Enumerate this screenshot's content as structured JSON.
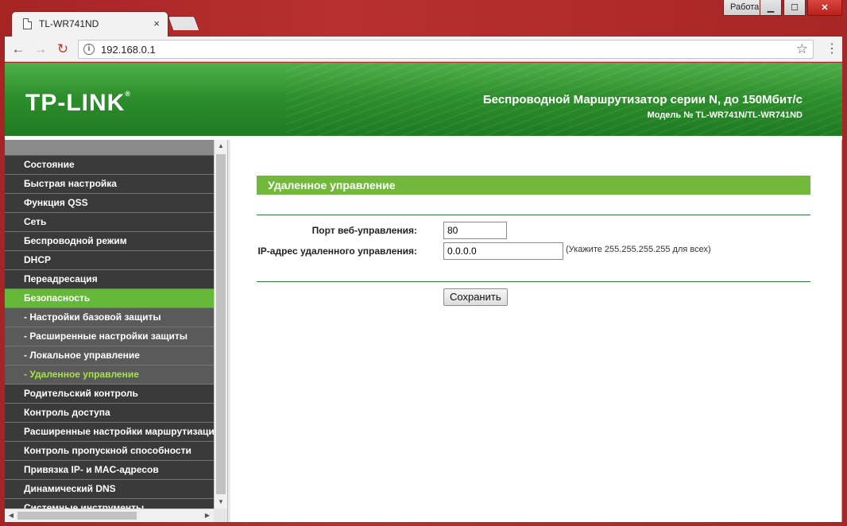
{
  "window": {
    "profile_label": "Работа",
    "minimize_icon": "minimize-icon",
    "maximize_icon": "maximize-icon",
    "close_icon": "close-icon"
  },
  "tab": {
    "title": "TL-WR741ND",
    "close_glyph": "×"
  },
  "toolbar": {
    "back_glyph": "←",
    "forward_glyph": "→",
    "reload_glyph": "↻",
    "url": "192.168.0.1",
    "info_glyph": "i",
    "star_glyph": "☆",
    "menu_glyph": "⋮"
  },
  "banner": {
    "logo": "TP-LINK",
    "logo_mark": "®",
    "headline": "Беспроводной Маршрутизатор серии N, до 150Мбит/с",
    "model": "Модель № TL-WR741N/TL-WR741ND"
  },
  "sidebar": {
    "items": [
      {
        "label": "Состояние",
        "kind": "main"
      },
      {
        "label": "Быстрая настройка",
        "kind": "main"
      },
      {
        "label": "Функция QSS",
        "kind": "main"
      },
      {
        "label": "Сеть",
        "kind": "main"
      },
      {
        "label": "Беспроводной режим",
        "kind": "main"
      },
      {
        "label": "DHCP",
        "kind": "main"
      },
      {
        "label": "Переадресация",
        "kind": "main"
      },
      {
        "label": "Безопасность",
        "kind": "active"
      },
      {
        "label": "- Настройки базовой защиты",
        "kind": "sub"
      },
      {
        "label": "- Расширенные настройки защиты",
        "kind": "sub"
      },
      {
        "label": "- Локальное управление",
        "kind": "sub"
      },
      {
        "label": "- Удаленное управление",
        "kind": "current"
      },
      {
        "label": "Родительский контроль",
        "kind": "main"
      },
      {
        "label": "Контроль доступа",
        "kind": "main"
      },
      {
        "label": "Расширенные настройки маршрутизации",
        "kind": "main"
      },
      {
        "label": "Контроль пропускной способности",
        "kind": "main"
      },
      {
        "label": "Привязка IP- и MAC-адресов",
        "kind": "main"
      },
      {
        "label": "Динамический DNS",
        "kind": "main"
      },
      {
        "label": "Системные инструменты",
        "kind": "main"
      }
    ],
    "scroll_up_glyph": "▲",
    "scroll_down_glyph": "▼",
    "scroll_left_glyph": "◀",
    "scroll_right_glyph": "▶"
  },
  "main": {
    "section_title": "Удаленное управление",
    "port_label": "Порт веб-управления:",
    "port_value": "80",
    "ip_label": "IP-адрес удаленного управления:",
    "ip_value": "0.0.0.0",
    "ip_hint": "(Укажите 255.255.255.255 для всех)",
    "save_label": "Сохранить"
  },
  "colors": {
    "frame": "#b02a2a",
    "banner_green": "#2e8f2c",
    "active_green": "#66b83a",
    "section_green": "#72b83a",
    "current_item": "#a5e34a"
  }
}
